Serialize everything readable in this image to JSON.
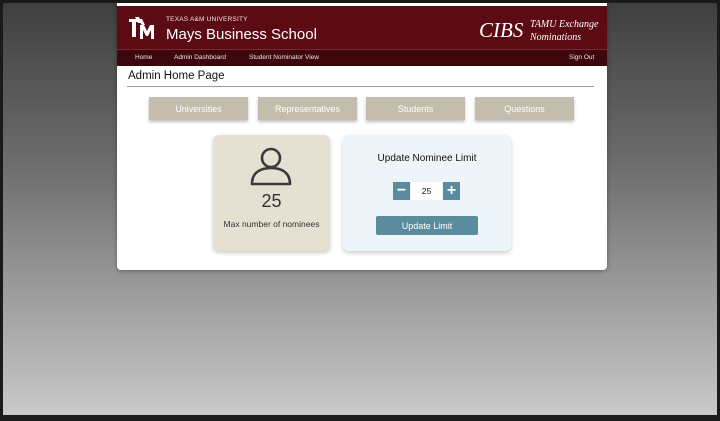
{
  "header": {
    "university": "TEXAS A&M UNIVERSITY",
    "school": "Mays Business School",
    "program_short": "CIBS",
    "program_line1": "TAMU Exchange",
    "program_line2": "Nominations"
  },
  "nav": {
    "home": "Home",
    "admin_dashboard": "Admin Dashboard",
    "student_nominator_view": "Student Nominator View",
    "sign_out": "Sign Out"
  },
  "page": {
    "title": "Admin Home Page"
  },
  "tabs": [
    "Universities",
    "Representatives",
    "Students",
    "Questions"
  ],
  "stats": {
    "icon": "person-icon",
    "value": "25",
    "label": "Max number of nominees"
  },
  "update_limit": {
    "title": "Update Nominee Limit",
    "minus": "−",
    "plus": "+",
    "value": "25",
    "button": "Update Limit"
  },
  "colors": {
    "banner": "#5c0a14",
    "nav": "#3d070c",
    "tab": "#c4bcac",
    "accent": "#5a8c9e",
    "stat_card": "#e6e0d3",
    "update_card": "#eef5f8"
  }
}
